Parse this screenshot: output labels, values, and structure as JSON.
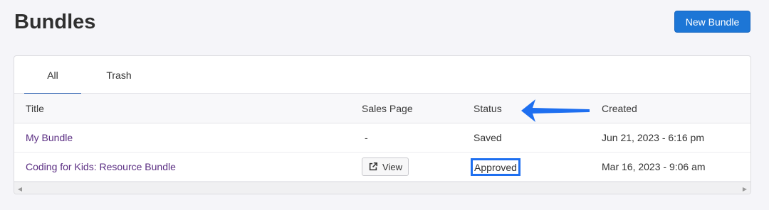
{
  "header": {
    "title": "Bundles",
    "new_button_label": "New Bundle"
  },
  "tabs": [
    {
      "label": "All",
      "active": true
    },
    {
      "label": "Trash",
      "active": false
    }
  ],
  "table": {
    "columns": [
      "Title",
      "Sales Page",
      "Status",
      "Created"
    ],
    "rows": [
      {
        "title": "My Bundle",
        "sales_page": "-",
        "status": "Saved",
        "created": "Jun 21, 2023 - 6:16 pm"
      },
      {
        "title": "Coding for Kids: Resource Bundle",
        "sales_page": "View",
        "status": "Approved",
        "created": "Mar 16, 2023 - 9:06 am"
      }
    ]
  },
  "icons": {
    "view": "external-link-icon",
    "annotation": "blue-arrow-icon",
    "scroll_left": "caret-left-icon",
    "scroll_right": "caret-right-icon"
  },
  "colors": {
    "primary": "#1d76d6",
    "link": "#5a2d82",
    "highlight": "#1e6ff0",
    "tab_underline": "#2a5fb0"
  }
}
